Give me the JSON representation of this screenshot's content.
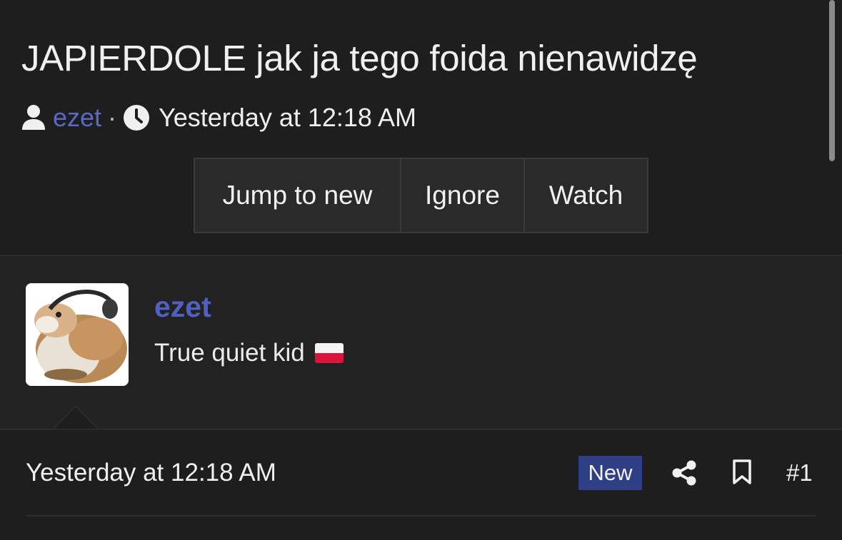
{
  "thread": {
    "title": "JAPIERDOLE jak ja tego foida nienawidzę",
    "author": "ezet",
    "separator": "·",
    "date": "Yesterday at 12:18 AM"
  },
  "actions": {
    "jump_label": "Jump to new",
    "ignore_label": "Ignore",
    "watch_label": "Watch"
  },
  "post": {
    "username": "ezet",
    "user_title": "True quiet kid",
    "flag_icon": "poland-flag-icon",
    "date": "Yesterday at 12:18 AM",
    "badge": "New",
    "number": "#1",
    "share_icon": "share-icon",
    "bookmark_icon": "bookmark-icon"
  },
  "colors": {
    "background": "#1e1e1f",
    "link": "#5b68c4",
    "badge_bg": "#2e3f86"
  }
}
